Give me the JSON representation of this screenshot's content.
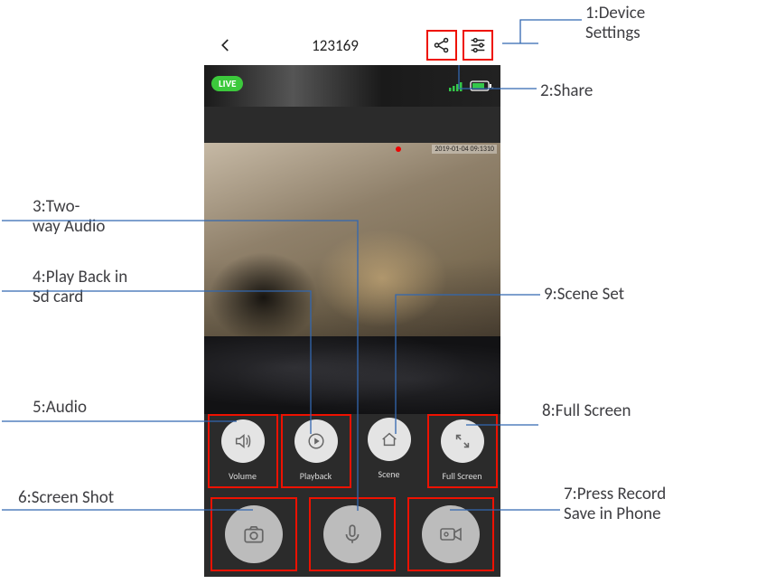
{
  "header": {
    "title": "123169",
    "back_icon": "back-icon",
    "share_icon": "share-icon",
    "settings_icon": "sliders-icon"
  },
  "status": {
    "live_label": "LIVE",
    "timestamp": "2019-01-04 09:1310"
  },
  "smallButtons": [
    {
      "name": "volume",
      "label": "Volume",
      "icon": "speaker-icon"
    },
    {
      "name": "playback",
      "label": "Playback",
      "icon": "play-circle-icon"
    },
    {
      "name": "scene",
      "label": "Scene",
      "icon": "home-icon"
    },
    {
      "name": "fullscreen",
      "label": "Full Screen",
      "icon": "expand-icon"
    }
  ],
  "bigButtons": [
    {
      "name": "screenshot",
      "icon": "camera-icon"
    },
    {
      "name": "mic",
      "icon": "microphone-icon"
    },
    {
      "name": "record",
      "icon": "video-camera-icon"
    }
  ],
  "annotations": {
    "a1": "1:Device\nSettings",
    "a2": "2:Share",
    "a3": "3:Two-\nway Audio",
    "a4": "4:Play Back in\nSd card",
    "a5": "5:Audio",
    "a6": "6:Screen Shot",
    "a7": "7:Press Record\nSave in Phone",
    "a8": "8:Full Screen",
    "a9": "9:Scene Set"
  },
  "redBoxed": {
    "header_share": true,
    "header_settings": true,
    "small_volume": true,
    "small_playback": true,
    "small_fullscreen": true,
    "big_screenshot": true,
    "big_mic": true,
    "big_record": true
  }
}
